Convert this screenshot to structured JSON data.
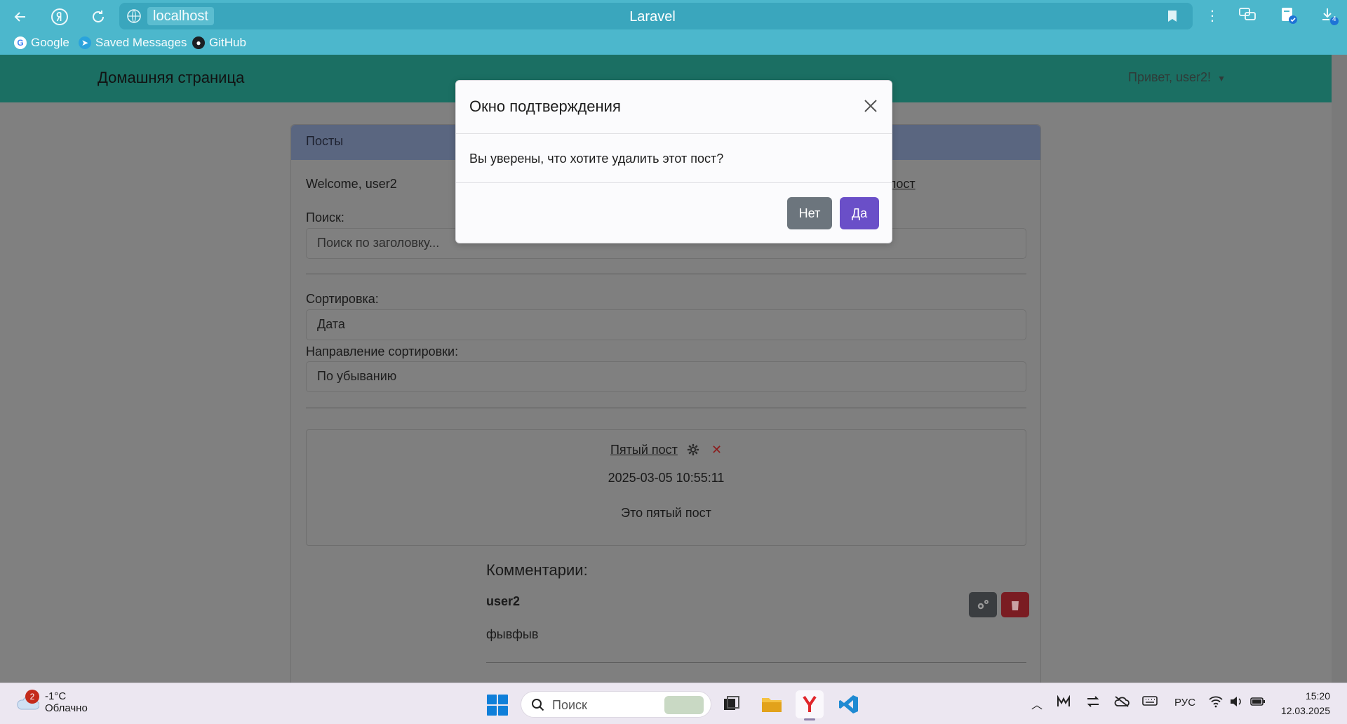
{
  "browser": {
    "host": "localhost",
    "tab_title": "Laravel",
    "download_count": "4",
    "bookmarks": [
      {
        "label": "Google",
        "icon": "google-icon"
      },
      {
        "label": "Saved Messages",
        "icon": "telegram-icon"
      },
      {
        "label": "GitHub",
        "icon": "github-icon"
      }
    ]
  },
  "navbar": {
    "brand": "Домашняя страница",
    "user_menu": "Привет, user2!"
  },
  "card": {
    "header": "Посты",
    "welcome": "Welcome, user2",
    "create_link": "ть пост",
    "search_label": "Поиск:",
    "search_placeholder": "Поиск по заголовку...",
    "sort_label": "Сортировка:",
    "sort_value": "Дата",
    "direction_label": "Направление сортировки:",
    "direction_value": "По убыванию"
  },
  "post": {
    "title": "Пятый пост",
    "date": "2025-03-05 10:55:11",
    "body": "Это пятый пост"
  },
  "comments": {
    "heading": "Комментарии:",
    "items": [
      {
        "user": "user2",
        "text": "фывфыв"
      }
    ]
  },
  "modal": {
    "title": "Окно подтверждения",
    "body": "Вы уверены, что хотите удалить этот пост?",
    "no_label": "Нет",
    "yes_label": "Да"
  },
  "taskbar": {
    "weather_badge": "2",
    "weather_temp": "-1°C",
    "weather_cond": "Облачно",
    "search_placeholder": "Поиск",
    "language": "РУС",
    "time": "15:20",
    "date": "12.03.2025"
  },
  "colors": {
    "browser_bar": "#4cb7cc",
    "navbar": "#1b6f63",
    "btn_no": "#6c757d",
    "btn_yes": "#6a4fc8"
  }
}
